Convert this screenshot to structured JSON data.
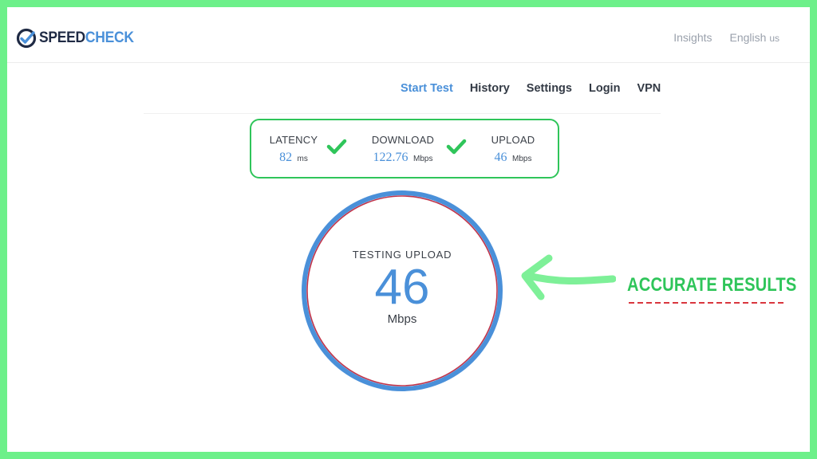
{
  "header": {
    "logo": {
      "part1": "SPEED",
      "part2": "CHECK"
    },
    "links": {
      "insights": "Insights",
      "language": "English",
      "language_region": "us"
    }
  },
  "nav": {
    "items": [
      "Start Test",
      "History",
      "Settings",
      "Login",
      "VPN"
    ],
    "active": "Start Test"
  },
  "metrics": {
    "latency": {
      "label": "LATENCY",
      "value": "82",
      "unit": "ms",
      "status": "complete"
    },
    "download": {
      "label": "DOWNLOAD",
      "value": "122.76",
      "unit": "Mbps",
      "status": "complete"
    },
    "upload": {
      "label": "UPLOAD",
      "value": "46",
      "unit": "Mbps",
      "status": "in-progress"
    }
  },
  "gauge": {
    "label": "TESTING UPLOAD",
    "value": "46",
    "unit": "Mbps"
  },
  "annotation": {
    "text": "ACCURATE RESULTS"
  },
  "colors": {
    "accent": "#4a90d9",
    "success": "#2fc55a",
    "frame": "#6df08a",
    "gauge_ring": "#4a90d9",
    "gauge_inner": "#c0344a",
    "underline": "#d9363e",
    "text": "#333a45"
  },
  "icons": [
    "speedcheck-logo-icon",
    "checkmark-icon",
    "arrow-left-icon"
  ]
}
